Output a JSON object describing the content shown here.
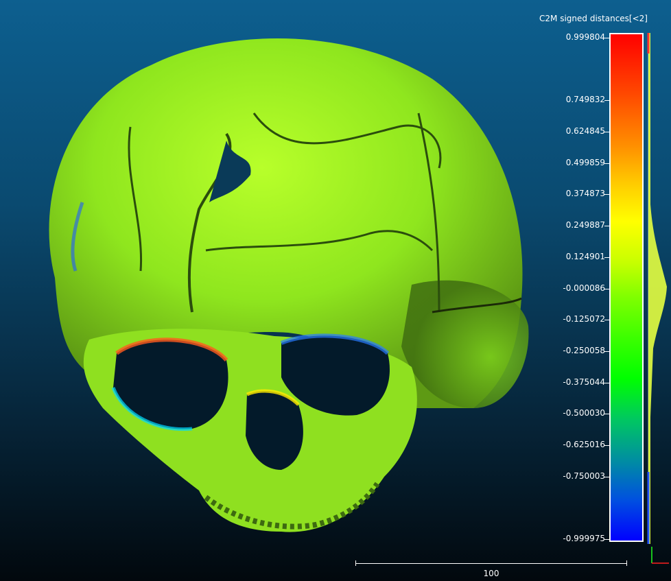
{
  "scalar_field": {
    "title": "C2M signed distances[<2]",
    "ticks": [
      {
        "label": "0.999804",
        "value": 0.999804
      },
      {
        "label": "0.749832",
        "value": 0.749832
      },
      {
        "label": "0.624845",
        "value": 0.624845
      },
      {
        "label": "0.499859",
        "value": 0.499859
      },
      {
        "label": "0.374873",
        "value": 0.374873
      },
      {
        "label": "0.249887",
        "value": 0.249887
      },
      {
        "label": "0.124901",
        "value": 0.124901
      },
      {
        "label": "-0.000086",
        "value": -8.6e-05
      },
      {
        "label": "-0.125072",
        "value": -0.125072
      },
      {
        "label": "-0.250058",
        "value": -0.250058
      },
      {
        "label": "-0.375044",
        "value": -0.375044
      },
      {
        "label": "-0.500030",
        "value": -0.50003
      },
      {
        "label": "-0.625016",
        "value": -0.625016
      },
      {
        "label": "-0.750003",
        "value": -0.750003
      },
      {
        "label": "-0.999975",
        "value": -0.999975
      }
    ],
    "range": {
      "min": -0.999975,
      "max": 0.999804
    },
    "colors": {
      "max": "#ff0000",
      "mid": "#7fff00",
      "min": "#0000ff",
      "histogram": "#e6ff40"
    }
  },
  "scale_bar": {
    "label": "100"
  },
  "axis_widget": {
    "x_color": "#ff2020",
    "y_color": "#20ff20"
  },
  "viewport": {
    "object_icon": "skull-mesh-icon"
  }
}
